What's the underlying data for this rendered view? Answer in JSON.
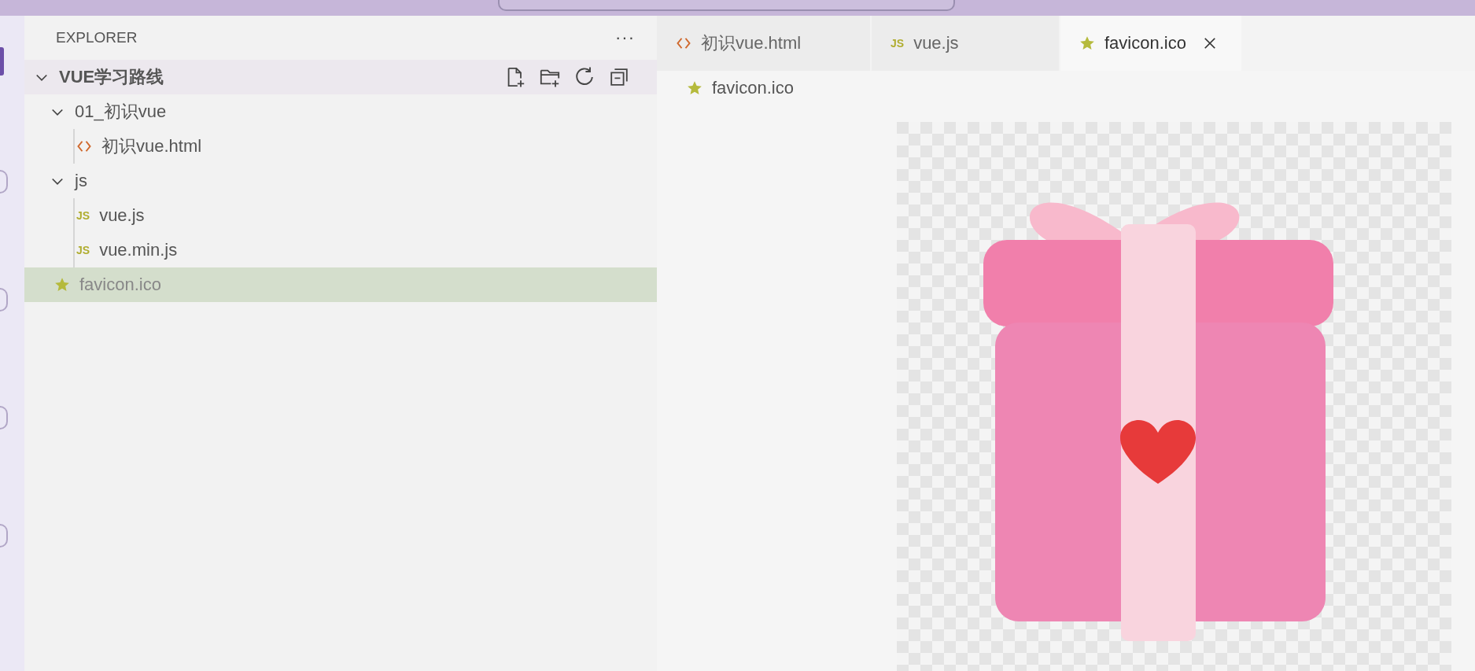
{
  "sidebar": {
    "title": "EXPLORER",
    "more": "···",
    "tree": [
      {
        "label": "VUE学习路线",
        "kind": "root",
        "expanded": true,
        "selected": false,
        "children": [
          {
            "label": "01_初识vue",
            "kind": "folder",
            "expanded": true,
            "selected": false,
            "children": [
              {
                "label": "初识vue.html",
                "kind": "html",
                "selected": false
              }
            ]
          },
          {
            "label": "js",
            "kind": "folder",
            "expanded": true,
            "selected": false,
            "children": [
              {
                "label": "vue.js",
                "kind": "js",
                "badge": "JS",
                "selected": false
              },
              {
                "label": "vue.min.js",
                "kind": "js",
                "badge": "JS",
                "selected": false
              }
            ]
          },
          {
            "label": "favicon.ico",
            "kind": "image",
            "selected": true
          }
        ]
      }
    ]
  },
  "tabs": [
    {
      "label": "初识vue.html",
      "kind": "html",
      "selected": false
    },
    {
      "label": "vue.js",
      "kind": "js",
      "badge": "JS",
      "selected": false
    },
    {
      "label": "favicon.ico",
      "kind": "image",
      "selected": true
    }
  ],
  "breadcrumb": {
    "label": "favicon.ico",
    "kind": "image"
  }
}
